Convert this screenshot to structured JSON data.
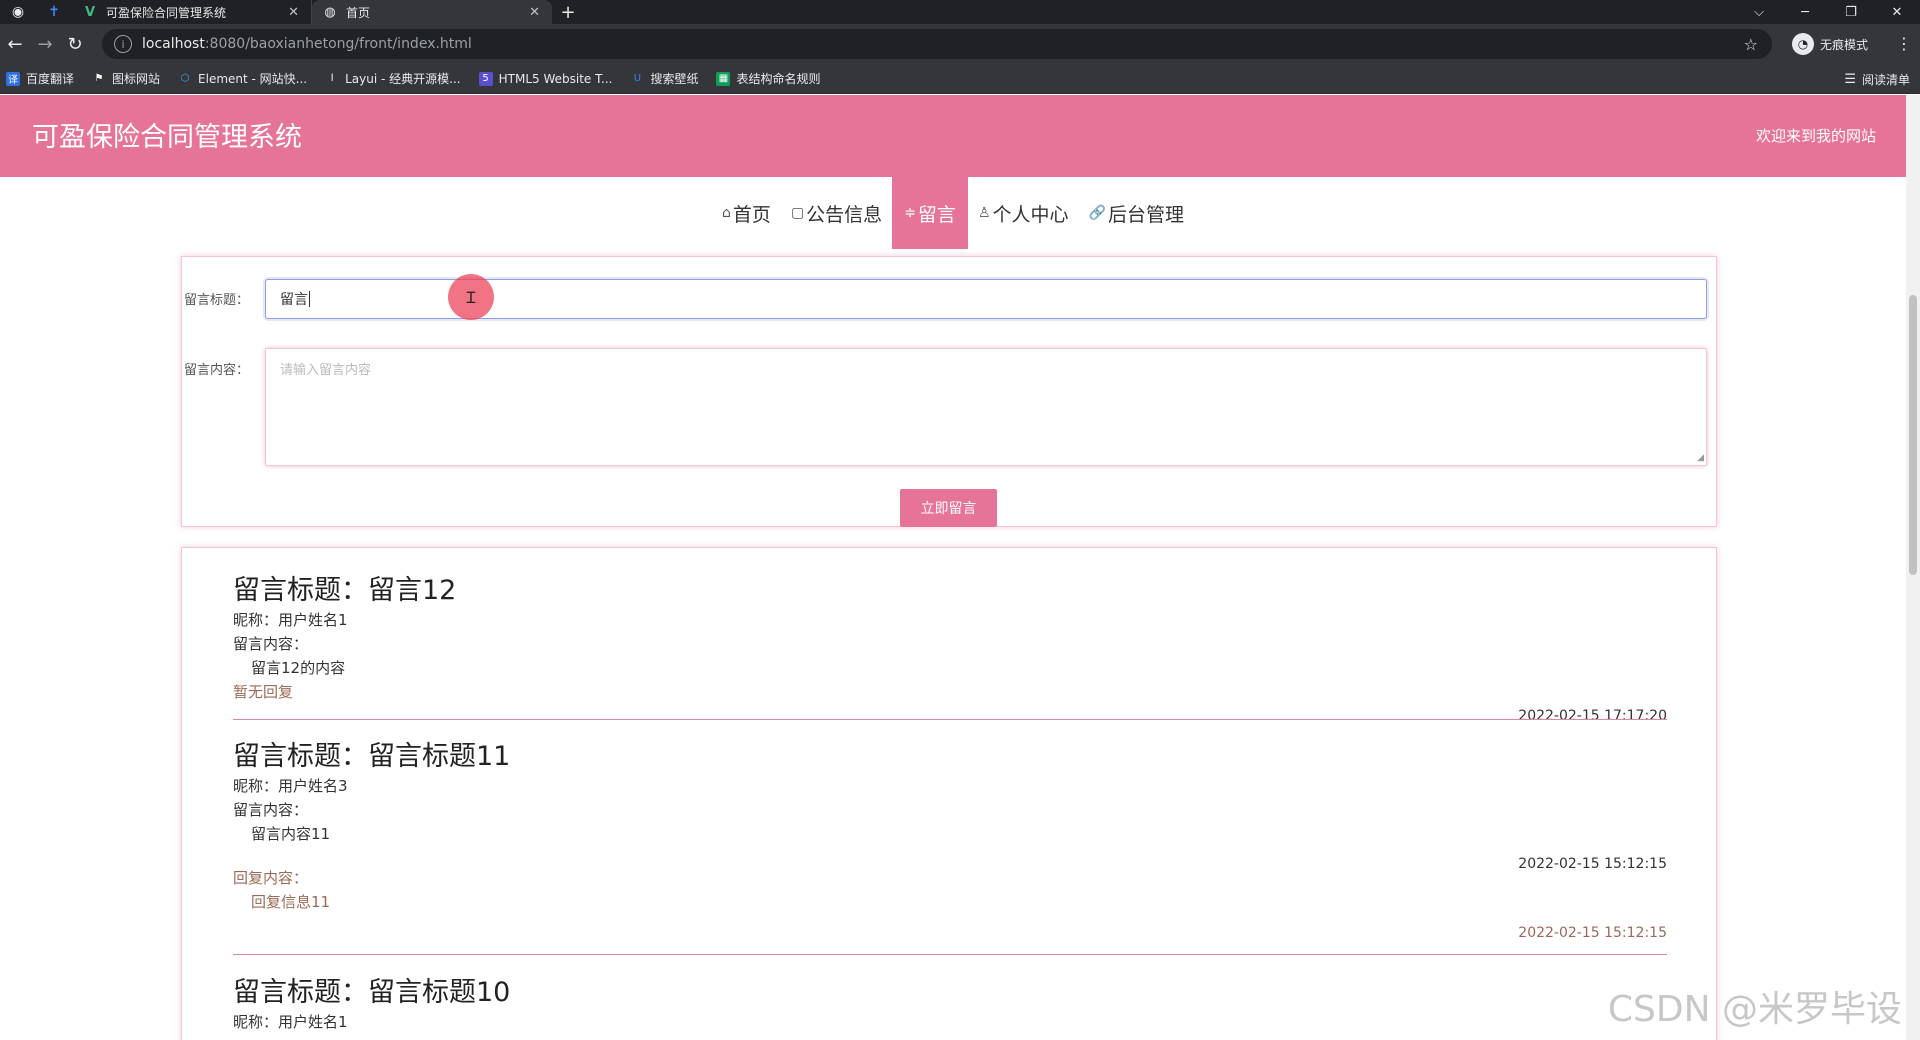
{
  "browser": {
    "tabs": [
      {
        "title": "可盈保险合同管理系统",
        "active": false
      },
      {
        "title": "首页",
        "active": true
      }
    ],
    "url_host": "localhost",
    "url_path": ":8080/baoxianhetong/front/index.html",
    "profile_label": "无痕模式",
    "bookmarks": [
      "百度翻译",
      "图标网站",
      "Element - 网站快...",
      "Layui - 经典开源模...",
      "HTML5 Website T...",
      "搜索壁纸",
      "表结构命名规则"
    ],
    "reading_list": "阅读清单"
  },
  "header": {
    "site_title": "可盈保险合同管理系统",
    "welcome": "欢迎来到我的网站"
  },
  "nav": [
    {
      "icon": "⌂",
      "label": "首页",
      "active": false
    },
    {
      "icon": "▢",
      "label": "公告信息",
      "active": false
    },
    {
      "icon": "≑",
      "label": "留言",
      "active": true
    },
    {
      "icon": "♙",
      "label": "个人中心",
      "active": false
    },
    {
      "icon": "🔗",
      "label": "后台管理",
      "active": false
    }
  ],
  "form": {
    "title_label": "留言标题：",
    "title_value": "留言",
    "content_label": "留言内容：",
    "content_placeholder": "请输入留言内容",
    "submit_label": "立即留言"
  },
  "messages": [
    {
      "title": "留言标题：留言12",
      "nickname": "昵称：用户姓名1",
      "content_label": "留言内容：",
      "content": "留言12的内容",
      "no_reply": "暂无回复",
      "time": "2022-02-15 17:17:20"
    },
    {
      "title": "留言标题：留言标题11",
      "nickname": "昵称：用户姓名3",
      "content_label": "留言内容：",
      "content": "留言内容11",
      "time": "2022-02-15 15:12:15",
      "reply_label": "回复内容：",
      "reply": "回复信息11",
      "reply_time": "2022-02-15 15:12:15"
    },
    {
      "title": "留言标题：留言标题10",
      "nickname": "昵称：用户姓名1"
    }
  ],
  "watermark": "CSDN @米罗毕设",
  "colors": {
    "brand": "#e57498",
    "reply_text": "#9b6a57"
  }
}
